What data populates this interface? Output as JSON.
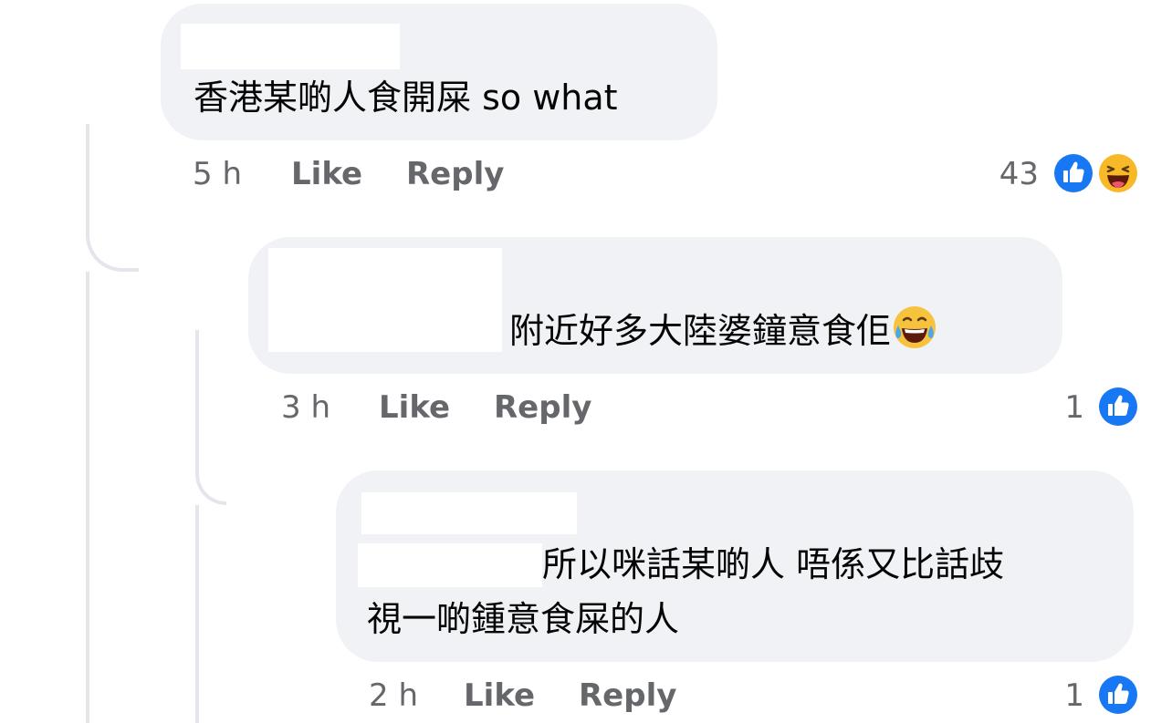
{
  "comments": [
    {
      "text": "香港某啲人食開屎 so what",
      "time": "5 h",
      "like_label": "Like",
      "reply_label": "Reply",
      "reaction_count": "43",
      "reactions": [
        "like-icon",
        "haha-icon"
      ]
    },
    {
      "text": "附近好多大陸婆鐘意食佢",
      "inline_emoji": "laughing-tears-emoji",
      "time": "3 h",
      "like_label": "Like",
      "reply_label": "Reply",
      "reaction_count": "1",
      "reactions": [
        "like-icon"
      ]
    },
    {
      "text_line1": "所以咪話某啲人 唔係又比話歧",
      "text_line2": "視一啲鍾意食屎的人",
      "time": "2 h",
      "like_label": "Like",
      "reply_label": "Reply",
      "reaction_count": "1",
      "reactions": [
        "like-icon"
      ]
    }
  ],
  "colors": {
    "bubble": "#f0f2f5",
    "meta_text": "#65676b",
    "like_blue": "#1877f2",
    "haha_yellow": "#f7b928",
    "thread_line": "#e4e6eb"
  }
}
